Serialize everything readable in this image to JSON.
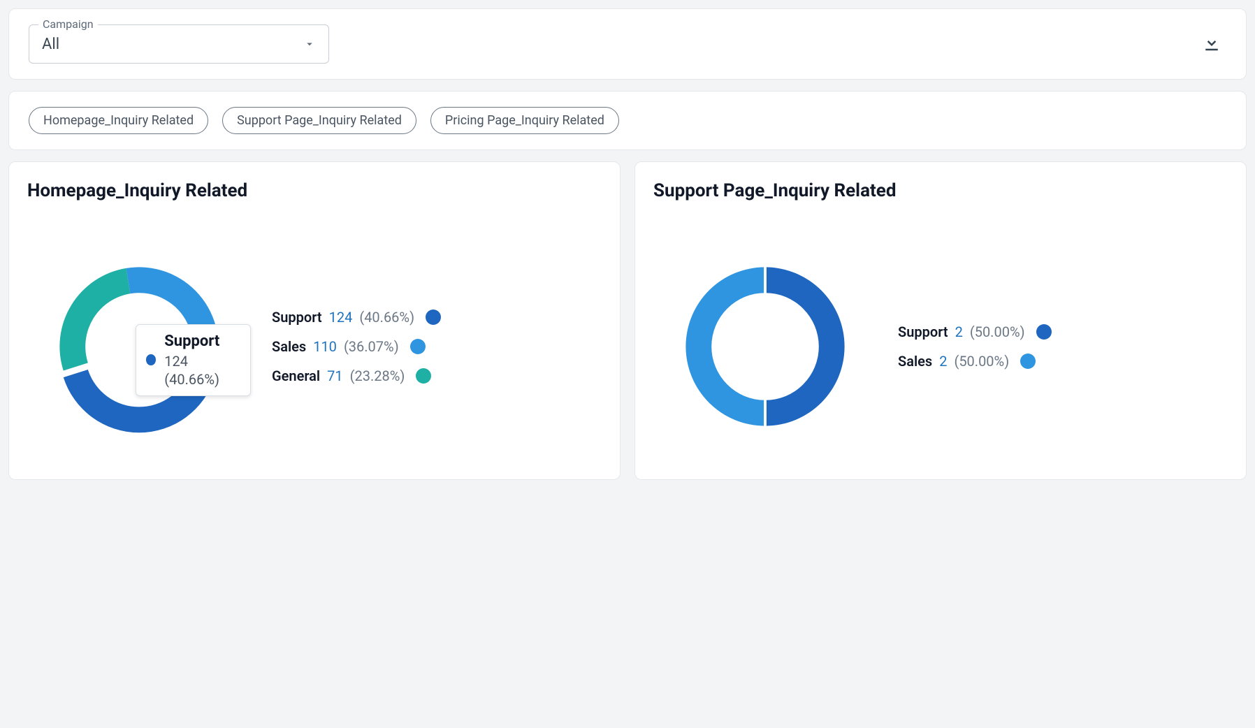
{
  "filter": {
    "label": "Campaign",
    "selected": "All"
  },
  "chips": [
    "Homepage_Inquiry Related",
    "Support Page_Inquiry Related",
    "Pricing Page_Inquiry Related"
  ],
  "colors": {
    "support": "#1e66c0",
    "sales": "#2f95e0",
    "general": "#1eb0a5"
  },
  "tooltip": {
    "name": "Support",
    "value": "124",
    "pct": "40.66%",
    "color": "#1e66c0"
  },
  "charts": {
    "left": {
      "title": "Homepage_Inquiry Related",
      "legend": [
        {
          "name": "Support",
          "value": "124",
          "pct": "40.66%",
          "color": "#1e66c0"
        },
        {
          "name": "Sales",
          "value": "110",
          "pct": "36.07%",
          "color": "#2f95e0"
        },
        {
          "name": "General",
          "value": "71",
          "pct": "23.28%",
          "color": "#1eb0a5"
        }
      ]
    },
    "right": {
      "title": "Support Page_Inquiry Related",
      "legend": [
        {
          "name": "Support",
          "value": "2",
          "pct": "50.00%",
          "color": "#1e66c0"
        },
        {
          "name": "Sales",
          "value": "2",
          "pct": "50.00%",
          "color": "#2f95e0"
        }
      ]
    }
  },
  "chart_data": [
    {
      "type": "pie",
      "title": "Homepage_Inquiry Related",
      "series": [
        {
          "name": "Support",
          "value": 124,
          "percent": 40.66
        },
        {
          "name": "Sales",
          "value": 110,
          "percent": 36.07
        },
        {
          "name": "General",
          "value": 71,
          "percent": 23.28
        }
      ]
    },
    {
      "type": "pie",
      "title": "Support Page_Inquiry Related",
      "series": [
        {
          "name": "Support",
          "value": 2,
          "percent": 50.0
        },
        {
          "name": "Sales",
          "value": 2,
          "percent": 50.0
        }
      ]
    }
  ]
}
